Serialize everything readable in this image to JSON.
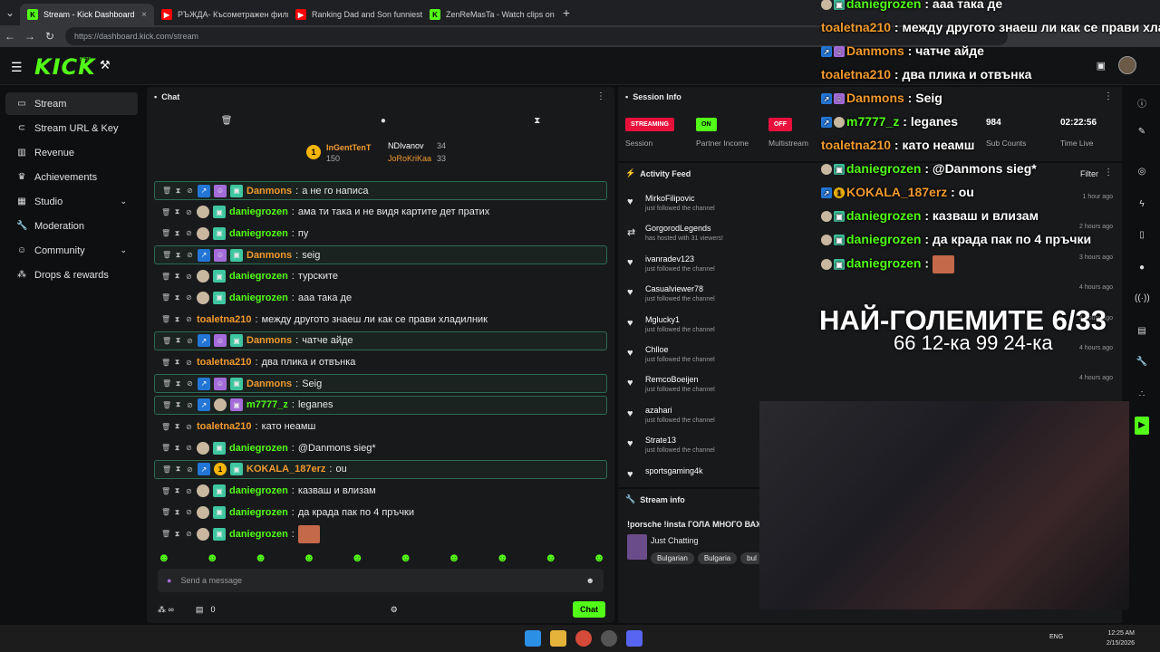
{
  "browser": {
    "tabs": [
      {
        "title": "Stream - Kick Dashboard",
        "icon": "kick-icon",
        "active": true
      },
      {
        "title": "РЪЖДА- Късометражен филм",
        "icon": "youtube-icon"
      },
      {
        "title": "Ranking Dad and Son funniest",
        "icon": "youtube-icon"
      },
      {
        "title": "ZenReMasTa - Watch clips on K",
        "icon": "kick-icon"
      }
    ],
    "url": "https://dashboard.kick.com/stream"
  },
  "header": {
    "logo": "KICK",
    "beta": "BETA"
  },
  "sidebar": {
    "items": [
      {
        "label": "Stream",
        "icon": "stream-icon"
      },
      {
        "label": "Stream URL & Key",
        "icon": "link-icon"
      },
      {
        "label": "Revenue",
        "icon": "revenue-icon"
      },
      {
        "label": "Achievements",
        "icon": "trophy-icon"
      },
      {
        "label": "Studio",
        "icon": "studio-icon"
      },
      {
        "label": "Moderation",
        "icon": "wrench-icon"
      },
      {
        "label": "Community",
        "icon": "community-icon"
      },
      {
        "label": "Drops & rewards",
        "icon": "drops-icon"
      }
    ]
  },
  "chat": {
    "title": "Chat",
    "pinned": [
      {
        "name": "InGentTenT",
        "value": "150",
        "rank": "1"
      },
      {
        "name": "NDIvanov",
        "value": "34"
      },
      {
        "name": "JoRoKriKaa",
        "value": "33"
      }
    ],
    "messages": [
      {
        "user": "Danmons",
        "color": "orange",
        "text": "а не го написа",
        "hl": true
      },
      {
        "user": "daniegrozen",
        "color": "green",
        "text": "ама ти така и не видя картите дет пратих"
      },
      {
        "user": "daniegrozen",
        "color": "green",
        "text": "пу"
      },
      {
        "user": "Danmons",
        "color": "orange",
        "text": "seig",
        "hl": true
      },
      {
        "user": "daniegrozen",
        "color": "green",
        "text": "турските"
      },
      {
        "user": "daniegrozen",
        "color": "green",
        "text": "ааа така де"
      },
      {
        "user": "toaletna210",
        "color": "orange",
        "text": "между другото знаеш ли как се прави хладилник"
      },
      {
        "user": "Danmons",
        "color": "orange",
        "text": "чатче айде",
        "hl": true
      },
      {
        "user": "toaletna210",
        "color": "orange",
        "text": "два плика и отвънка"
      },
      {
        "user": "Danmons",
        "color": "orange",
        "text": "Seig",
        "hl": true
      },
      {
        "user": "m7777_z",
        "color": "green",
        "text": "leganes",
        "hl": true
      },
      {
        "user": "toaletna210",
        "color": "orange",
        "text": "като неамш"
      },
      {
        "user": "daniegrozen",
        "color": "green",
        "text": "@Danmons sieg*"
      },
      {
        "user": "KOKALA_187erz",
        "color": "orange",
        "text": "ou",
        "hl": true
      },
      {
        "user": "daniegrozen",
        "color": "green",
        "text": "казваш и влизам"
      },
      {
        "user": "daniegrozen",
        "color": "green",
        "text": "да крада пак по 4 пръчки"
      },
      {
        "user": "daniegrozen",
        "color": "green",
        "text": ""
      }
    ],
    "input_placeholder": "Send a message",
    "footer_count": "0",
    "send_label": "Chat"
  },
  "session": {
    "title": "Session Info",
    "streaming": {
      "pill": "STREAMING",
      "label": "Session"
    },
    "partner": {
      "pill": "ON",
      "label": "Partner Income"
    },
    "multistream": {
      "pill": "OFF",
      "label": "Multistream"
    },
    "subs": {
      "value": "984",
      "label": "Sub Counts"
    },
    "time": {
      "value": "02:22:56",
      "label": "Time Live"
    }
  },
  "activity": {
    "title": "Activity Feed",
    "filter": "Filter",
    "items": [
      {
        "name": "MirkoFilipovic",
        "sub": "just followed the channel",
        "time": "1 hour ago"
      },
      {
        "name": "GorgorodLegends",
        "sub": "has hosted with 31 viewers!",
        "time": "2 hours ago"
      },
      {
        "name": "ivanradev123",
        "sub": "just followed the channel",
        "time": "3 hours ago"
      },
      {
        "name": "Casualviewer78",
        "sub": "just followed the channel",
        "time": "4 hours ago"
      },
      {
        "name": "Mglucky1",
        "sub": "just followed the channel",
        "time": "4 hours ago"
      },
      {
        "name": "Chlloe",
        "sub": "just followed the channel",
        "time": "4 hours ago"
      },
      {
        "name": "RemcoBoeijen",
        "sub": "just followed the channel",
        "time": "4 hours ago"
      },
      {
        "name": "azahari",
        "sub": "just followed the channel",
        "time": ""
      },
      {
        "name": "Strate13",
        "sub": "just followed the channel",
        "time": ""
      },
      {
        "name": "sportsgaming4k",
        "sub": "",
        "time": ""
      }
    ]
  },
  "stream_info": {
    "title": "Stream info",
    "stream_title": "!porsche !insta ГОЛА МНОГО ВАЖ",
    "category": "Just Chatting",
    "tags": [
      "Bulgarian",
      "Bulgaria",
      "bul"
    ]
  },
  "overlay": {
    "lines": [
      {
        "user": "daniegrozen",
        "color": "green",
        "text": "ааа така де"
      },
      {
        "user": "toaletna210",
        "color": "orange",
        "text": "между другото знаеш ли как се прави хлад"
      },
      {
        "user": "Danmons",
        "color": "orange",
        "text": "чатче айде"
      },
      {
        "user": "toaletna210",
        "color": "orange",
        "text": "два плика и отвънка"
      },
      {
        "user": "Danmons",
        "color": "orange",
        "text": "Seig"
      },
      {
        "user": "m7777_z",
        "color": "green",
        "text": "leganes"
      },
      {
        "user": "toaletna210",
        "color": "orange",
        "text": "като неамш"
      },
      {
        "user": "daniegrozen",
        "color": "green",
        "text": "@Danmons sieg*"
      },
      {
        "user": "KOKALA_187erz",
        "color": "orange",
        "text": "ou"
      },
      {
        "user": "daniegrozen",
        "color": "green",
        "text": "казваш и влизам"
      },
      {
        "user": "daniegrozen",
        "color": "green",
        "text": "да крада пак по 4 пръчки"
      },
      {
        "user": "daniegrozen",
        "color": "green",
        "text": ""
      }
    ],
    "big_title": "НАЙ-ГОЛЕМИТЕ 6/33",
    "big_sub": "66 12-ка 99 24-ка"
  },
  "taskbar": {
    "lang": "ENG",
    "time": "12:25 AM",
    "date": "2/15/2026"
  },
  "colors": {
    "accent": "#53fc18",
    "green_user": "#53fc18",
    "orange_user": "#f19a2e"
  }
}
